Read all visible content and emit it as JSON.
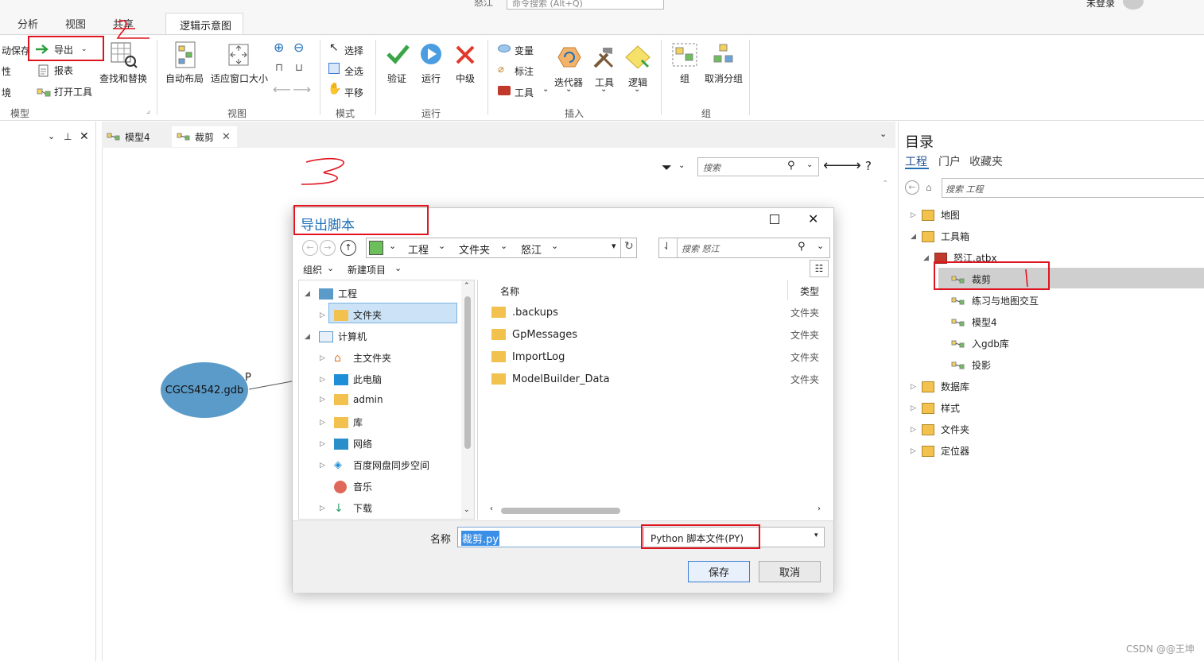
{
  "ribbon": {
    "tabs": [
      "分析",
      "视图",
      "共享"
    ],
    "active_tab": "逻辑示意图",
    "partial_top": "怒江",
    "top_search_placeholder": "命令搜索 (Alt+Q)",
    "user": "未登录",
    "model_group": {
      "auto_save": "动保存",
      "prop": "性",
      "env": "境",
      "export": "导出",
      "report": "报表",
      "open_tool": "打开工具",
      "find_replace": "查找和替换",
      "label": "模型"
    },
    "view_group": {
      "auto_layout": "自动布局",
      "fit_window": "适应窗口大小",
      "label": "视图"
    },
    "mode_group": {
      "select": "选择",
      "select_all": "全选",
      "pan": "平移",
      "label": "模式"
    },
    "run_group": {
      "validate": "验证",
      "run": "运行",
      "stop": "中级",
      "label": "运行"
    },
    "insert_group": {
      "variable": "变量",
      "label_item": "标注",
      "tools": "工具",
      "iterator": "迭代器",
      "tool": "工具",
      "logic": "逻辑",
      "label": "插入"
    },
    "group_group": {
      "group": "组",
      "ungroup": "取消分组",
      "label": "组"
    }
  },
  "doc_tabs": [
    {
      "label": "模型4"
    },
    {
      "label": "裁剪"
    }
  ],
  "canvas": {
    "search_placeholder": "搜索",
    "help": "?",
    "node_label": "CGCS4542.gdb",
    "param_label": "P"
  },
  "catalog": {
    "title": "目录",
    "tabs": [
      "工程",
      "门户",
      "收藏夹"
    ],
    "search_placeholder": "搜索 工程",
    "items": [
      {
        "label": "地图"
      },
      {
        "label": "工具箱"
      },
      {
        "label": "怒江.atbx"
      },
      {
        "label": "裁剪"
      },
      {
        "label": "练习与地图交互"
      },
      {
        "label": "模型4"
      },
      {
        "label": "入gdb库"
      },
      {
        "label": "投影"
      },
      {
        "label": "数据库"
      },
      {
        "label": "样式"
      },
      {
        "label": "文件夹"
      },
      {
        "label": "定位器"
      }
    ]
  },
  "dialog": {
    "title": "导出脚本",
    "breadcrumb": [
      "工程",
      "文件夹",
      "怒江"
    ],
    "search_placeholder": "搜索 怒江",
    "organize": "组织",
    "new_item": "新建项目",
    "tree": [
      {
        "label": "工程"
      },
      {
        "label": "文件夹"
      },
      {
        "label": "计算机"
      },
      {
        "label": "主文件夹"
      },
      {
        "label": "此电脑"
      },
      {
        "label": "admin"
      },
      {
        "label": "库"
      },
      {
        "label": "网络"
      },
      {
        "label": "百度网盘同步空间"
      },
      {
        "label": "音乐"
      },
      {
        "label": "下载"
      }
    ],
    "columns": {
      "name": "名称",
      "type": "类型"
    },
    "files": [
      {
        "name": ".backups",
        "type": "文件夹"
      },
      {
        "name": "GpMessages",
        "type": "文件夹"
      },
      {
        "name": "ImportLog",
        "type": "文件夹"
      },
      {
        "name": "ModelBuilder_Data",
        "type": "文件夹"
      }
    ],
    "filename_label": "名称",
    "filename_value": "裁剪.py",
    "filetype": "Python 脚本文件(PY)",
    "save": "保存",
    "cancel": "取消"
  },
  "watermark": "CSDN @@王坤",
  "colors": {
    "accent": "#1e6fb8",
    "annotation_red": "#e0141e",
    "node_fill": "#5b9bc9"
  }
}
